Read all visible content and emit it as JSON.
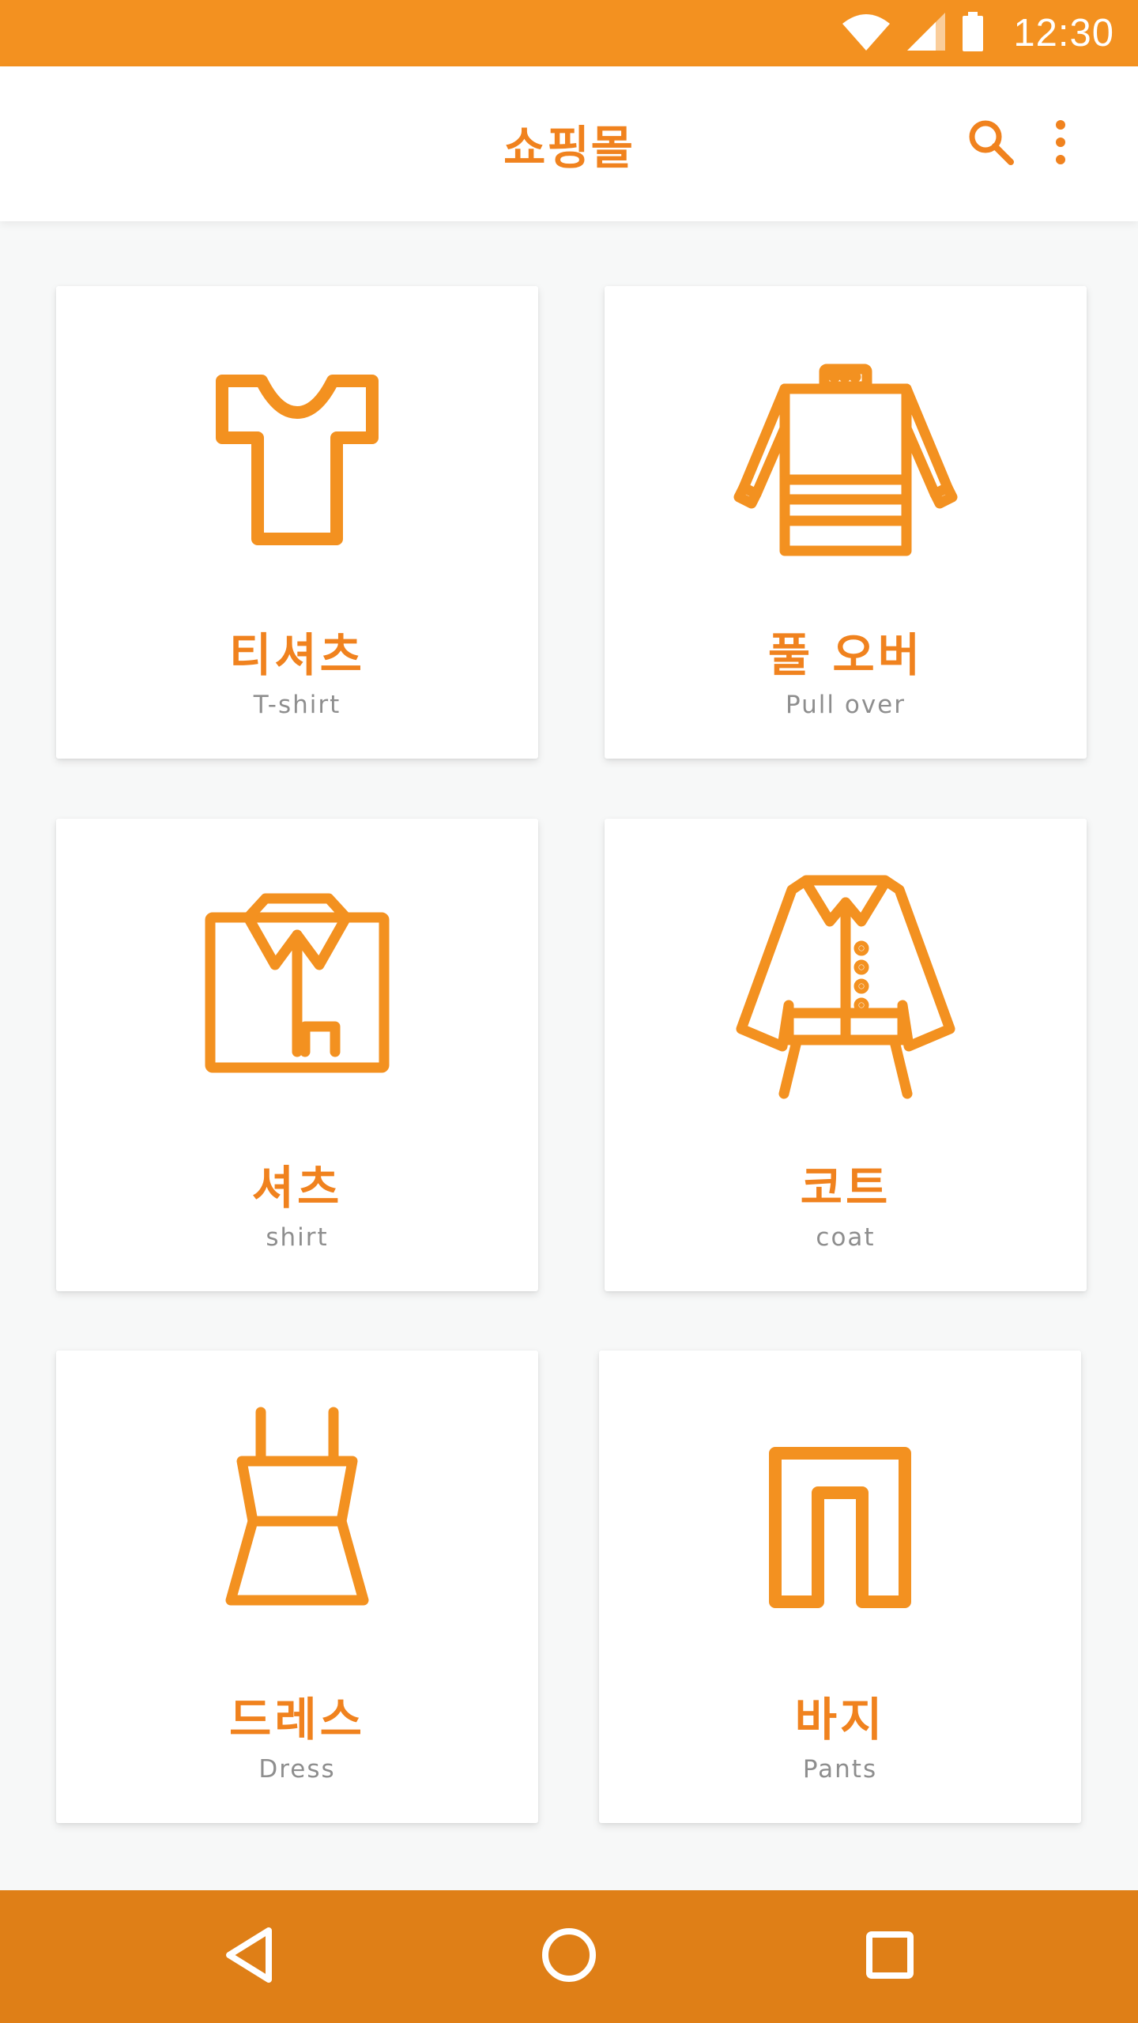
{
  "status_bar": {
    "time": "12:30",
    "icons": [
      "wifi-icon",
      "cell-signal-icon",
      "battery-icon"
    ]
  },
  "app_bar": {
    "title": "쇼핑몰",
    "actions": [
      "search-icon",
      "more-vert-icon"
    ]
  },
  "categories": [
    {
      "title": "티셔츠",
      "subtitle": "T-shirt",
      "icon": "tshirt-icon"
    },
    {
      "title": "풀 오버",
      "subtitle": "Pull over",
      "icon": "pullover-icon"
    },
    {
      "title": "셔츠",
      "subtitle": "shirt",
      "icon": "shirt-icon"
    },
    {
      "title": "코트",
      "subtitle": "coat",
      "icon": "coat-icon"
    },
    {
      "title": "드레스",
      "subtitle": "Dress",
      "icon": "dress-icon"
    },
    {
      "title": "바지",
      "subtitle": "Pants",
      "icon": "pants-icon"
    }
  ],
  "nav_bar": {
    "buttons": [
      "back-icon",
      "home-icon",
      "recents-icon"
    ]
  },
  "colors": {
    "accent": "#f0821e",
    "status_bar": "#f39120",
    "nav_bar": "#df7f17",
    "background": "#f7f8f8",
    "subtitle": "#8e8e8e"
  }
}
